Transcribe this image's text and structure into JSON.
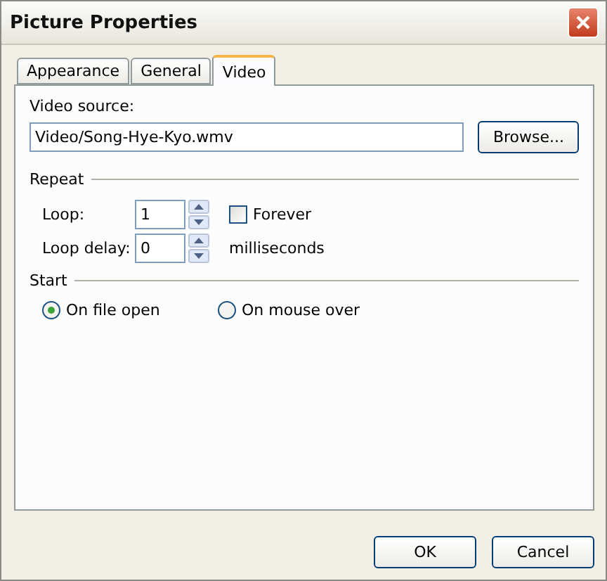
{
  "window": {
    "title": "Picture Properties"
  },
  "tabs": [
    {
      "label": "Appearance",
      "selected": false
    },
    {
      "label": "General",
      "selected": false
    },
    {
      "label": "Video",
      "selected": true
    }
  ],
  "video_source": {
    "label": "Video source:",
    "value": "Video/Song-Hye-Kyo.wmv",
    "browse_button": "Browse..."
  },
  "repeat": {
    "heading": "Repeat",
    "loop": {
      "label": "Loop:",
      "value": "1"
    },
    "forever": {
      "label": "Forever",
      "checked": false
    },
    "loop_delay": {
      "label": "Loop delay:",
      "value": "0",
      "unit": "milliseconds"
    }
  },
  "start": {
    "heading": "Start",
    "options": [
      {
        "label": "On file open",
        "selected": true
      },
      {
        "label": "On mouse over",
        "selected": false
      }
    ]
  },
  "buttons": [
    "OK",
    "Cancel"
  ]
}
